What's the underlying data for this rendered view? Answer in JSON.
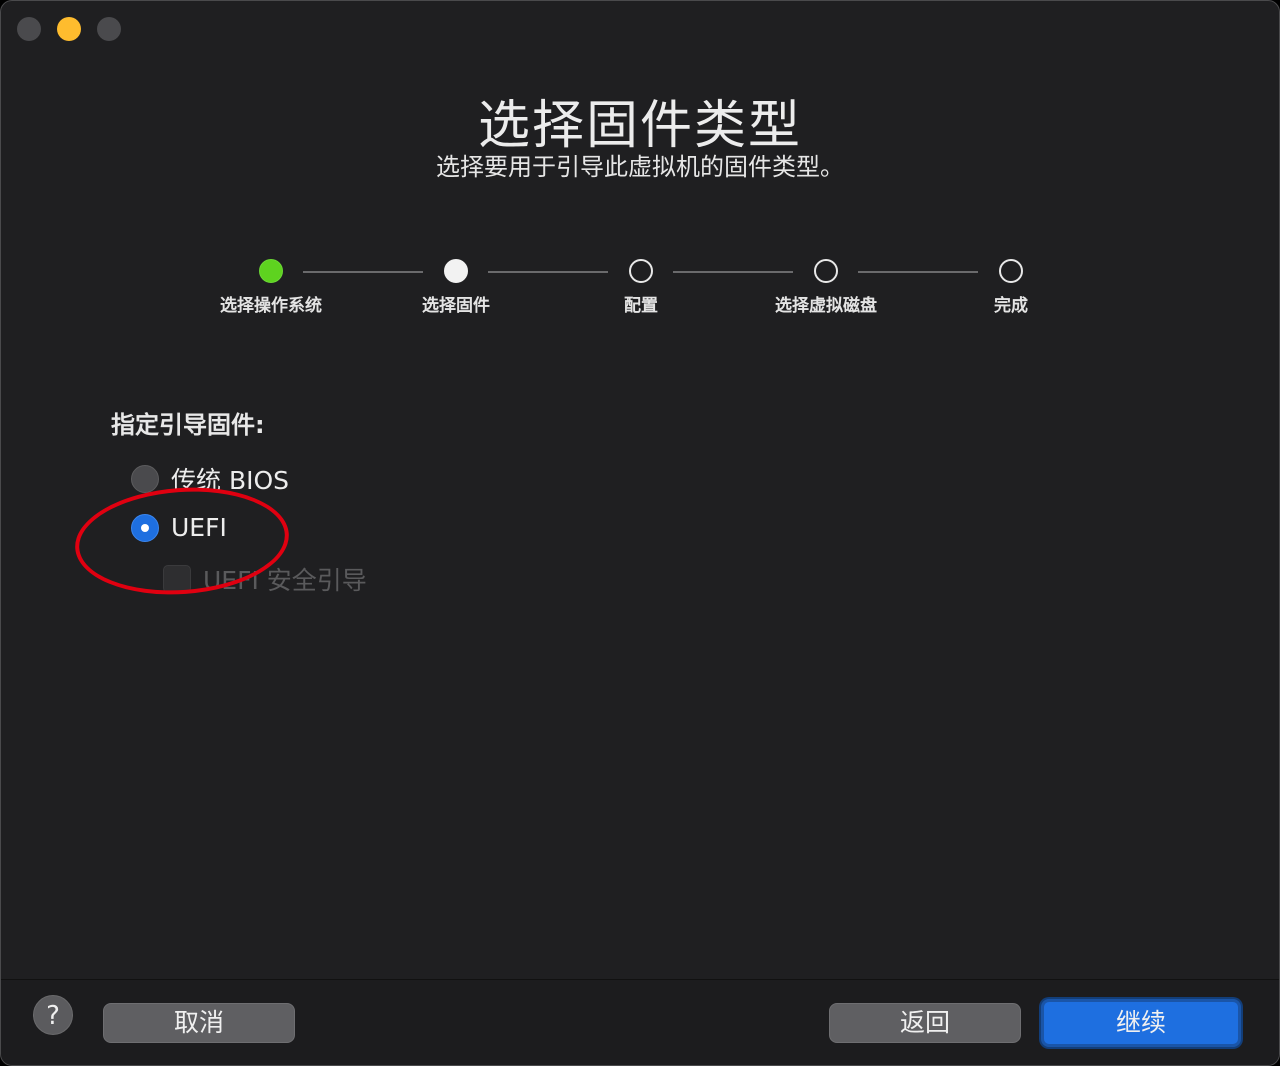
{
  "window": {
    "title": "选择固件类型",
    "subtitle": "选择要用于引导此虚拟机的固件类型。"
  },
  "stepper": {
    "steps": [
      {
        "label": "选择操作系统",
        "state": "done"
      },
      {
        "label": "选择固件",
        "state": "current"
      },
      {
        "label": "配置",
        "state": "pending"
      },
      {
        "label": "选择虚拟磁盘",
        "state": "pending"
      },
      {
        "label": "完成",
        "state": "pending"
      }
    ]
  },
  "firmware": {
    "section_label": "指定引导固件:",
    "options": [
      {
        "label": "传统 BIOS",
        "selected": false
      },
      {
        "label": "UEFI",
        "selected": true
      }
    ],
    "secure_boot": {
      "label": "UEFI 安全引导",
      "checked": false,
      "enabled": false
    }
  },
  "footer": {
    "help_label": "?",
    "cancel_label": "取消",
    "back_label": "返回",
    "continue_label": "继续"
  },
  "colors": {
    "accent": "#1e6fe0",
    "step_done": "#5ed31f",
    "annotation": "#e00010",
    "background": "#1f1f21"
  }
}
